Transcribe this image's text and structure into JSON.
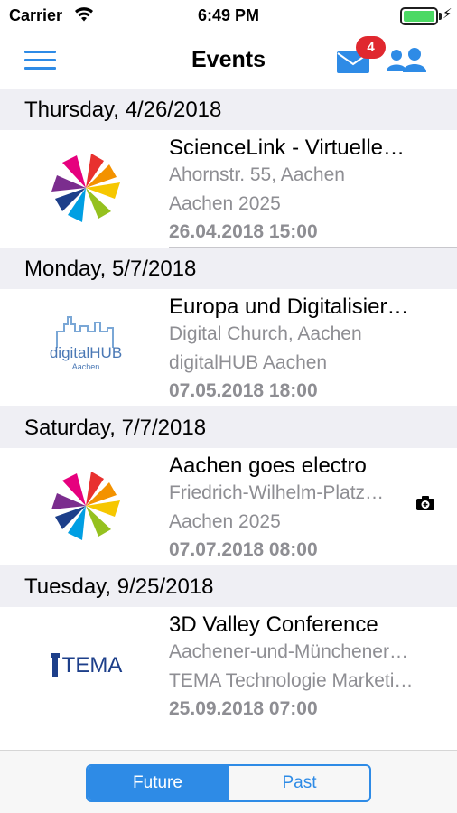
{
  "status_bar": {
    "carrier": "Carrier",
    "time": "6:49 PM"
  },
  "nav": {
    "title": "Events",
    "mail_badge": "4"
  },
  "sections": [
    {
      "header": "Thursday, 4/26/2018",
      "event": {
        "logo": "aachen-2025-logo",
        "title": "ScienceLink - Virtuelle…",
        "line1": "Ahornstr. 55, Aachen",
        "line2": "Aachen 2025",
        "datetime": "26.04.2018 15:00"
      }
    },
    {
      "header": "Monday, 5/7/2018",
      "event": {
        "logo": "digitalhub-aachen-logo",
        "logo_text": "digitalHUB",
        "logo_sub": "Aachen",
        "title": "Europa und Digitalisier…",
        "line1": "Digital Church, Aachen",
        "line2": "digitalHUB Aachen",
        "datetime": "07.05.2018 18:00"
      }
    },
    {
      "header": "Saturday, 7/7/2018",
      "event": {
        "logo": "aachen-2025-logo",
        "title": "Aachen goes electro",
        "line1": "Friedrich-Wilhelm-Platz…",
        "line2": "Aachen 2025",
        "datetime": "07.07.2018 08:00"
      }
    },
    {
      "header": "Tuesday, 9/25/2018",
      "event": {
        "logo": "tema-logo",
        "logo_text": "TEMA",
        "title": "3D Valley Conference",
        "line1": "Aachener-und-Münchener…",
        "line2": "TEMA Technologie Marketi…",
        "datetime": "25.09.2018 07:00"
      }
    }
  ],
  "segmented": {
    "future": "Future",
    "past": "Past",
    "selected": "Future"
  },
  "colors": {
    "accent": "#2e8be6",
    "badge": "#e0282f",
    "section_bg": "#efeff4",
    "secondary_text": "#8e8e93",
    "battery": "#4cd964"
  },
  "icons": [
    "wifi-icon",
    "battery-icon",
    "charging-icon",
    "menu-icon",
    "mail-icon",
    "people-icon",
    "camera-icon"
  ]
}
